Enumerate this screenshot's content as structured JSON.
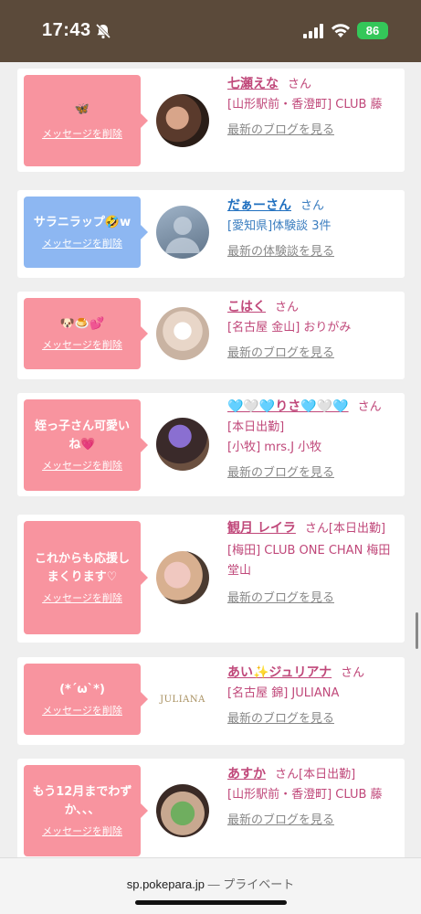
{
  "status": {
    "time": "17:43",
    "battery": "86"
  },
  "cards": [
    {
      "message": "🦋",
      "delete_label": "メッセージを削除",
      "name": "七瀬えな",
      "honorific": "さん",
      "shop": "[山形駅前・香澄町] CLUB 藤",
      "link": "最新のブログを見る"
    },
    {
      "message": "サラニラップ🤣w",
      "delete_label": "メッセージを削除",
      "name": "だぁーさん",
      "honorific": "さん",
      "shop": "[愛知県]体験談 3件",
      "link": "最新の体験談を見る",
      "avatar_text": "no photo"
    },
    {
      "message": "🐶🍮💕",
      "delete_label": "メッセージを削除",
      "name": "こはく",
      "honorific": "さん",
      "shop": "[名古屋 金山] おりがみ",
      "link": "最新のブログを見る"
    },
    {
      "message": "姪っ子さん可愛いね💗",
      "delete_label": "メッセージを削除",
      "name": "🩵🤍🩵りさ🩵🤍🩵",
      "honorific": "さん",
      "status": "[本日出勤]",
      "shop": "[小牧] mrs.J 小牧",
      "link": "最新のブログを見る"
    },
    {
      "message": "これからも応援しまくります♡",
      "delete_label": "メッセージを削除",
      "name": "観月 レイラ",
      "honorific": "さん",
      "status": "[本日出勤]",
      "shop": "[梅田] CLUB ONE CHAN 梅田堂山",
      "link": "最新のブログを見る"
    },
    {
      "message": "(*´ω`*)",
      "delete_label": "メッセージを削除",
      "name": "あい✨ジュリアナ",
      "honorific": "さん",
      "shop": "[名古屋 錦] JULIANA",
      "link": "最新のブログを見る",
      "logo_text": "JULIANA"
    },
    {
      "message": "もう12月までわずか、、、",
      "delete_label": "メッセージを削除",
      "name": "あすか",
      "honorific": "さん",
      "status": "[本日出勤]",
      "shop": "[山形駅前・香澄町] CLUB 藤",
      "link": "最新のブログを見る"
    }
  ],
  "browser": {
    "domain": "sp.pokepara.jp",
    "mode": "— プライベート"
  }
}
